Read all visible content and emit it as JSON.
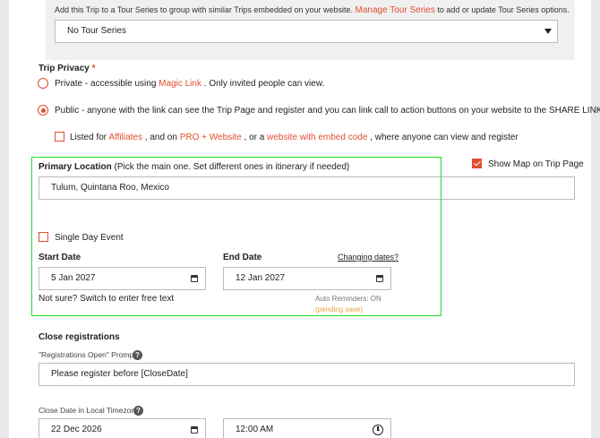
{
  "tour_series": {
    "help_prefix": "Add this Trip to a Tour Series to group with similar Trips embedded on your website.",
    "help_link": "Manage Tour Series",
    "help_suffix": "to add or update Tour Series options.",
    "selected": "No Tour Series"
  },
  "trip_privacy": {
    "label": "Trip Privacy",
    "required_mark": "*",
    "private_prefix": "Private - accessible using",
    "private_link": "Magic Link",
    "private_suffix": ". Only invited people can view.",
    "public_text": "Public - anyone with the link can see the Trip Page and register and you can link call to action buttons on your website to the SHARE LINK",
    "listed_prefix": "Listed for",
    "listed_link1": "Affiliates",
    "listed_mid1": ", and on",
    "listed_link2": "PRO + Website",
    "listed_mid2": ", or a",
    "listed_link3": "website with embed code",
    "listed_suffix": ", where anyone can view and register",
    "selected": "public",
    "listed_checked": false
  },
  "location": {
    "label": "Primary Location",
    "hint": "(Pick the main one. Set different ones in itinerary if needed)",
    "value": "Tulum, Quintana Roo, Mexico",
    "show_map_label": "Show Map on Trip Page",
    "show_map_checked": true
  },
  "dates": {
    "single_day_label": "Single Day Event",
    "single_day_checked": false,
    "start_label": "Start Date",
    "start_value": "5 Jan 2027",
    "end_label": "End Date",
    "end_value": "12 Jan 2027",
    "changing_link": "Changing dates?",
    "free_text_link": "Not sure? Switch to enter free text",
    "auto_reminders": "Auto Reminders: ON",
    "pending": "(pending save)"
  },
  "registrations": {
    "section_label": "Close registrations",
    "prompt_label": "\"Registrations Open\" Prompt",
    "prompt_value": "Please register before [CloseDate]",
    "close_date_label": "Close Date in Local Timezone",
    "close_date_value": "22 Dec 2026",
    "close_time_value": "12:00 AM"
  },
  "colors": {
    "accent": "#e04e2f",
    "highlight": "#22dd22",
    "pending": "#f0a040"
  }
}
